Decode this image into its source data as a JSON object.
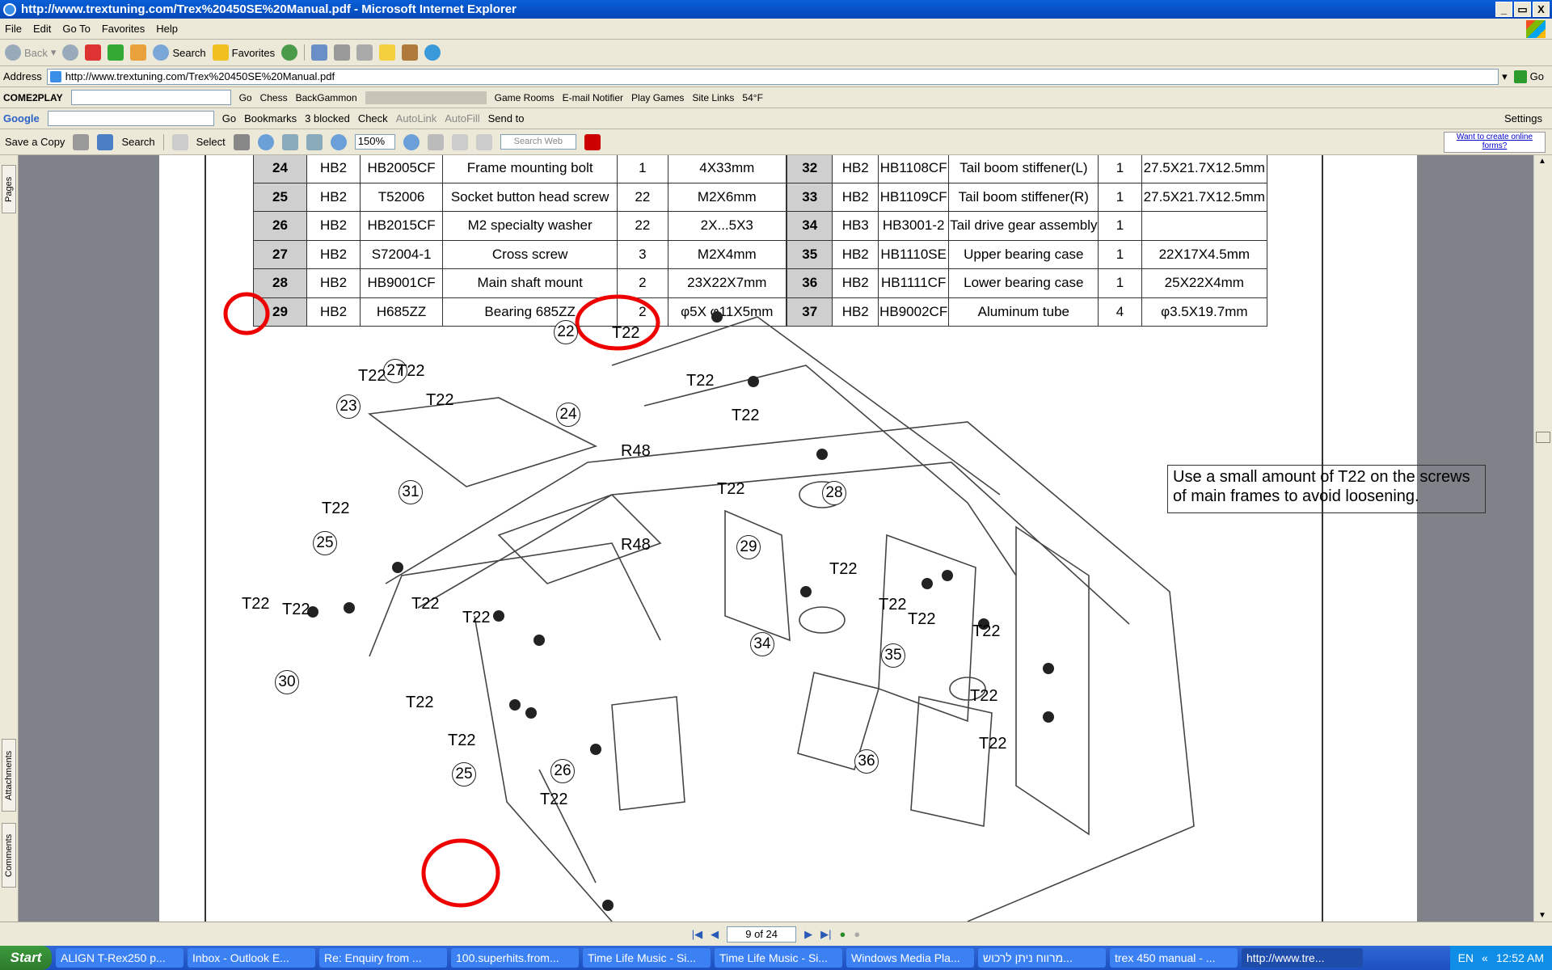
{
  "window": {
    "title": "http://www.trextuning.com/Trex%20450SE%20Manual.pdf - Microsoft Internet Explorer",
    "btn_min": "_",
    "btn_max": "▭",
    "btn_close": "X"
  },
  "menu": [
    "File",
    "Edit",
    "Go To",
    "Favorites",
    "Help"
  ],
  "nav": {
    "back": "Back",
    "search": "Search",
    "favorites": "Favorites"
  },
  "address": {
    "label": "Address",
    "url": "http://www.trextuning.com/Trex%20450SE%20Manual.pdf",
    "go": "Go"
  },
  "c2p": {
    "brand": "COME2PLAY",
    "go": "Go",
    "chess": "Chess",
    "backgammon": "BackGammon",
    "gamerooms": "Game Rooms",
    "email": "E-mail Notifier",
    "playgames": "Play Games",
    "sitelinks": "Site Links",
    "weather": "54°F"
  },
  "google": {
    "brand": "Google",
    "go": "Go",
    "bookmarks": "Bookmarks",
    "blocked": "3 blocked",
    "check": "Check",
    "autolink": "AutoLink",
    "autofill": "AutoFill",
    "sendto": "Send to",
    "settings": "Settings"
  },
  "acrobat": {
    "save": "Save a Copy",
    "search": "Search",
    "select": "Select",
    "zoom": "150%",
    "searchweb": "Search Web",
    "tooltip": "Want to create online forms?"
  },
  "side_tabs": {
    "pages": "Pages",
    "attachments": "Attachments",
    "comments": "Comments"
  },
  "parts_left": [
    [
      "24",
      "HB2",
      "HB2005CF",
      "Frame mounting  bolt",
      "1",
      "4X33mm"
    ],
    [
      "25",
      "HB2",
      "T52006",
      "Socket button head screw",
      "22",
      "M2X6mm"
    ],
    [
      "26",
      "HB2",
      "HB2015CF",
      "M2 specialty washer",
      "22",
      "2X...5X3"
    ],
    [
      "27",
      "HB2",
      "S72004-1",
      "Cross screw",
      "3",
      "M2X4mm"
    ],
    [
      "28",
      "HB2",
      "HB9001CF",
      "Main shaft mount",
      "2",
      "23X22X7mm"
    ],
    [
      "29",
      "HB2",
      "H685ZZ",
      "Bearing 685ZZ",
      "2",
      "φ5X φ11X5mm"
    ]
  ],
  "parts_right": [
    [
      "32",
      "HB2",
      "HB1108CF",
      "Tail boom stiffener(L)",
      "1",
      "27.5X21.7X12.5mm"
    ],
    [
      "33",
      "HB2",
      "HB1109CF",
      "Tail boom stiffener(R)",
      "1",
      "27.5X21.7X12.5mm"
    ],
    [
      "34",
      "HB3",
      "HB3001-2",
      "Tail drive gear assembly",
      "1",
      ""
    ],
    [
      "35",
      "HB2",
      "HB1110SE",
      "Upper bearing case",
      "1",
      "22X17X4.5mm"
    ],
    [
      "36",
      "HB2",
      "HB1111CF",
      "Lower bearing case",
      "1",
      "25X22X4mm"
    ],
    [
      "37",
      "HB2",
      "HB9002CF",
      "Aluminum tube",
      "4",
      "φ3.5X19.7mm"
    ]
  ],
  "diagram": {
    "note": "Use a small amount of T22 on the screws of main frames to avoid loosening.",
    "callouts": [
      "22",
      "27",
      "23",
      "24",
      "31",
      "28",
      "29",
      "25",
      "30",
      "34",
      "35",
      "26",
      "25",
      "36"
    ],
    "labels": [
      "T22",
      "T22",
      "T22",
      "T22",
      "T22",
      "T22",
      "R48",
      "R48",
      "T22",
      "T22",
      "T22",
      "T22",
      "T22",
      "T22",
      "T22",
      "T22",
      "T22",
      "T22",
      "T22",
      "T22",
      "T22",
      "T22",
      "T22"
    ]
  },
  "status": {
    "page": "9 of 24"
  },
  "taskbar": {
    "start": "Start",
    "tasks": [
      "ALIGN T-Rex250 p...",
      "Inbox - Outlook E...",
      "Re: Enquiry from ...",
      "100.superhits.from...",
      "Time Life Music - Si...",
      "Time Life Music - Si...",
      "Windows Media Pla...",
      "מרווח ניתן לרכוש...",
      "trex 450 manual - ...",
      "http://www.tre..."
    ],
    "lang": "EN",
    "clock": "12:52 AM"
  },
  "colors": {
    "title_bar": "#0a5fd6",
    "chrome": "#ece9d8",
    "taskbar": "#245edb",
    "annotation": "#e00000"
  }
}
